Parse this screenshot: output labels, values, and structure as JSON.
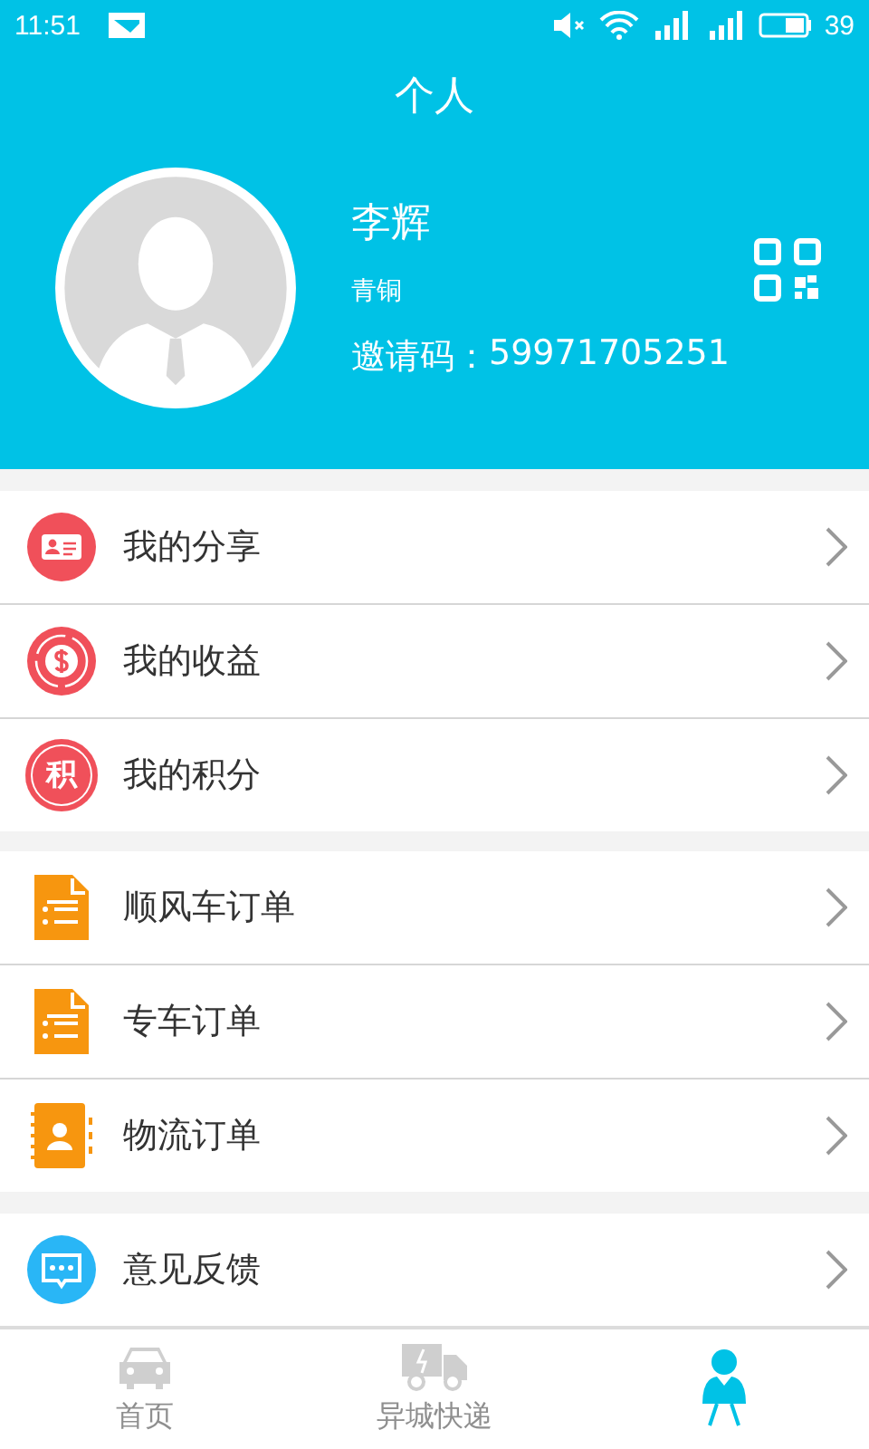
{
  "status_bar": {
    "time": "11:51",
    "battery": "39"
  },
  "header": {
    "title": "个人",
    "name": "李辉",
    "level": "青铜",
    "invite_label": "邀请码：",
    "invite_code": "59971705251"
  },
  "menu_groups": [
    [
      {
        "label": "我的分享",
        "kind": "card"
      },
      {
        "label": "我的收益",
        "kind": "dollar"
      },
      {
        "label": "我的积分",
        "kind": "points",
        "icon_text": "积"
      }
    ],
    [
      {
        "label": "顺风车订单",
        "kind": "doc"
      },
      {
        "label": "专车订单",
        "kind": "doc"
      },
      {
        "label": "物流订单",
        "kind": "book"
      }
    ],
    [
      {
        "label": "意见反馈",
        "kind": "chat"
      }
    ]
  ],
  "tabs": [
    {
      "label": "首页",
      "kind": "car",
      "selected": false
    },
    {
      "label": "异城快递",
      "kind": "truck",
      "selected": false
    },
    {
      "kind": "person",
      "selected": true
    }
  ]
}
